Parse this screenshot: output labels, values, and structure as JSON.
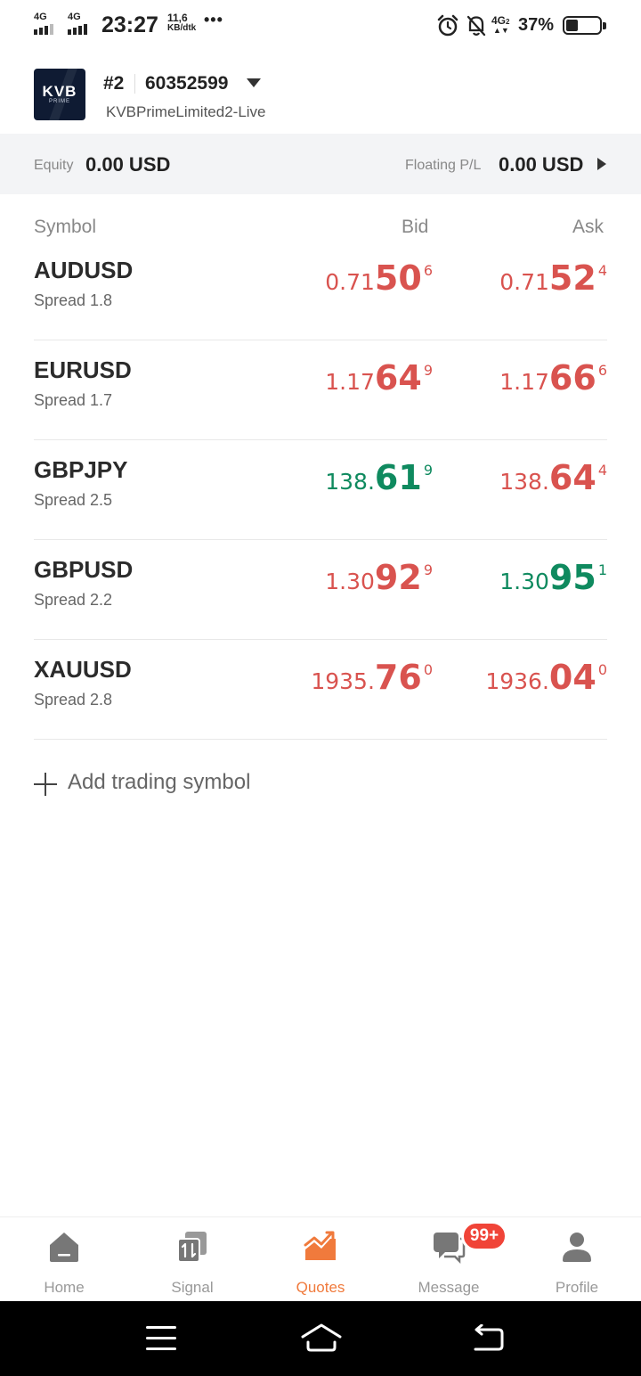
{
  "status_bar": {
    "sim1": "4G",
    "sim2": "4G",
    "time": "23:27",
    "net_speed": "11,6",
    "net_unit": "KB/dtk",
    "more": "•••",
    "icons": [
      "alarm-icon",
      "bell-off-icon",
      "4g-icon"
    ],
    "net_badge": "4G",
    "battery": "37%",
    "battery_level": 0.37
  },
  "account": {
    "logo_text": "KVB",
    "logo_sub": "PRIME",
    "number": "#2",
    "id": "60352599",
    "server": "KVBPrimeLimited2-Live"
  },
  "equity": {
    "label": "Equity",
    "value": "0.00 USD",
    "floating_label": "Floating P/L",
    "floating_value": "0.00 USD"
  },
  "table": {
    "headers": {
      "symbol": "Symbol",
      "bid": "Bid",
      "ask": "Ask"
    },
    "rows": [
      {
        "symbol": "AUDUSD",
        "spread": "Spread 1.8",
        "bid": {
          "a": "0.71",
          "b": "50",
          "c": "6",
          "color": "red"
        },
        "ask": {
          "a": "0.71",
          "b": "52",
          "c": "4",
          "color": "red"
        }
      },
      {
        "symbol": "EURUSD",
        "spread": "Spread 1.7",
        "bid": {
          "a": "1.17",
          "b": "64",
          "c": "9",
          "color": "red"
        },
        "ask": {
          "a": "1.17",
          "b": "66",
          "c": "6",
          "color": "red"
        }
      },
      {
        "symbol": "GBPJPY",
        "spread": "Spread 2.5",
        "bid": {
          "a": "138.",
          "b": "61",
          "c": "9",
          "color": "green"
        },
        "ask": {
          "a": "138.",
          "b": "64",
          "c": "4",
          "color": "red"
        }
      },
      {
        "symbol": "GBPUSD",
        "spread": "Spread 2.2",
        "bid": {
          "a": "1.30",
          "b": "92",
          "c": "9",
          "color": "red"
        },
        "ask": {
          "a": "1.30",
          "b": "95",
          "c": "1",
          "color": "green"
        }
      },
      {
        "symbol": "XAUUSD",
        "spread": "Spread 2.8",
        "bid": {
          "a": "1935.",
          "b": "76",
          "c": "0",
          "color": "red"
        },
        "ask": {
          "a": "1936.",
          "b": "04",
          "c": "0",
          "color": "red"
        }
      }
    ]
  },
  "add_symbol": "Add trading symbol",
  "tabs": [
    {
      "label": "Home",
      "icon": "home-icon"
    },
    {
      "label": "Signal",
      "icon": "signal-icon"
    },
    {
      "label": "Quotes",
      "icon": "quotes-icon",
      "active": true
    },
    {
      "label": "Message",
      "icon": "message-icon"
    },
    {
      "label": "Profile",
      "icon": "profile-icon"
    }
  ],
  "message_badge": "99+",
  "colors": {
    "red": "#d9534f",
    "green": "#0f8a5f",
    "accent": "#f07a3c"
  }
}
